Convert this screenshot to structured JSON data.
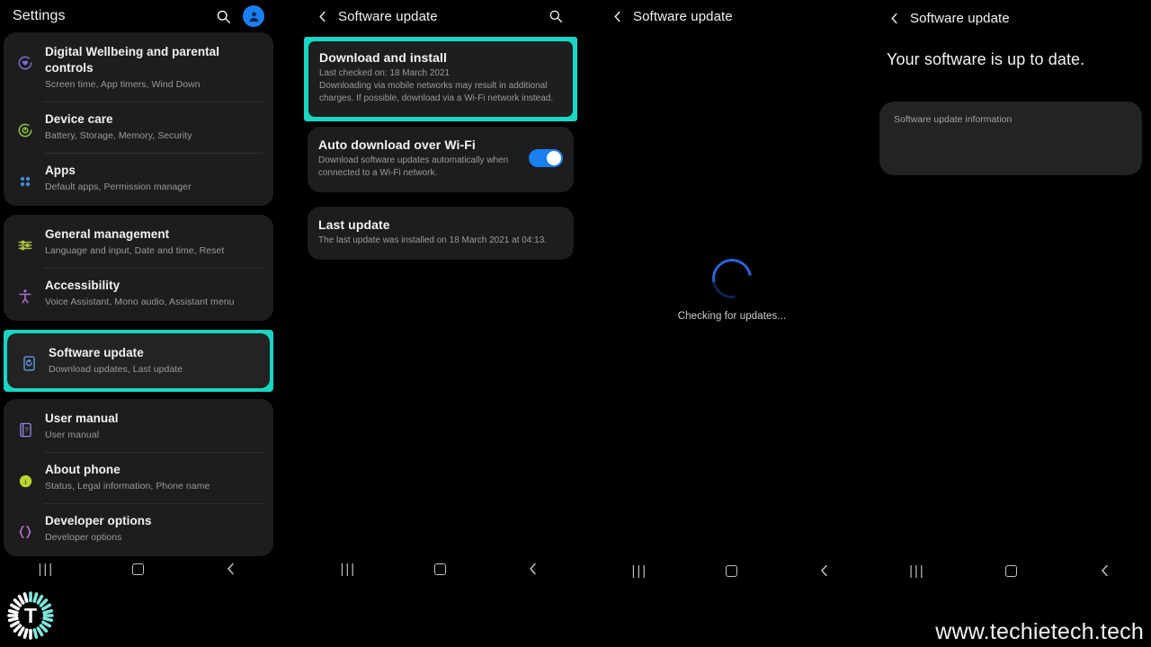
{
  "watermark": "www.techietech.tech",
  "logo": {
    "letter": "T"
  },
  "colors": {
    "highlight": "#17d6c4",
    "accent_blue": "#1a7ff0",
    "spinner_blue": "#2962d9",
    "card_bg": "#1d1d1d",
    "page_bg": "#000000"
  },
  "navbar": {
    "recents": "|||",
    "home": "home-square",
    "back": "‹"
  },
  "panel1": {
    "header": {
      "title": "Settings",
      "search_icon": "search-icon",
      "avatar_icon": "account-avatar"
    },
    "groups": [
      {
        "items": [
          {
            "title": "Digital Wellbeing and parental controls",
            "subtitle": "Screen time, App timers, Wind Down",
            "icon": "digital-wellbeing-icon",
            "icon_color": "#7e6ad6"
          },
          {
            "title": "Device care",
            "subtitle": "Battery, Storage, Memory, Security",
            "icon": "device-care-icon",
            "icon_color": "#8cc63e"
          },
          {
            "title": "Apps",
            "subtitle": "Default apps, Permission manager",
            "icon": "apps-icon",
            "icon_color": "#3d8fd6"
          }
        ]
      },
      {
        "items": [
          {
            "title": "General management",
            "subtitle": "Language and input, Date and time, Reset",
            "icon": "general-management-icon",
            "icon_color": "#a9c23f"
          },
          {
            "title": "Accessibility",
            "subtitle": "Voice Assistant, Mono audio, Assistant menu",
            "icon": "accessibility-icon",
            "icon_color": "#a86fd6"
          }
        ]
      },
      {
        "highlighted": true,
        "items": [
          {
            "title": "Software update",
            "subtitle": "Download updates, Last update",
            "icon": "software-update-icon",
            "icon_color": "#5b9ee8"
          }
        ]
      },
      {
        "items": [
          {
            "title": "User manual",
            "subtitle": "User manual",
            "icon": "user-manual-icon",
            "icon_color": "#8f86e0"
          },
          {
            "title": "About phone",
            "subtitle": "Status, Legal information, Phone name",
            "icon": "about-phone-icon",
            "icon_color": "#bcd52e"
          },
          {
            "title": "Developer options",
            "subtitle": "Developer options",
            "icon": "developer-options-icon",
            "icon_color": "#c77ad6"
          }
        ]
      }
    ]
  },
  "panel2": {
    "header": {
      "title": "Software update",
      "back_icon": "back-chevron-icon",
      "search_icon": "search-icon"
    },
    "download_and_install": {
      "title": "Download and install",
      "last_checked": "Last checked on: 18 March 2021",
      "description": "Downloading via mobile networks may result in additional charges. If possible, download via a Wi-Fi network instead.",
      "highlighted": true
    },
    "auto_download": {
      "title": "Auto download over Wi-Fi",
      "description": "Download software updates automatically when connected to a Wi-Fi network.",
      "toggle_state": "on"
    },
    "last_update": {
      "title": "Last update",
      "description": "The last update was installed on 18 March 2021 at 04:13."
    }
  },
  "panel3": {
    "header": {
      "title": "Software update",
      "back_icon": "back-chevron-icon"
    },
    "status": {
      "label": "Checking for updates...",
      "spinner": "loading-spinner"
    }
  },
  "panel4": {
    "header": {
      "title": "Software update",
      "back_icon": "back-chevron-icon"
    },
    "heading": "Your software is up to date.",
    "info_card": {
      "label": "Software update information"
    }
  }
}
